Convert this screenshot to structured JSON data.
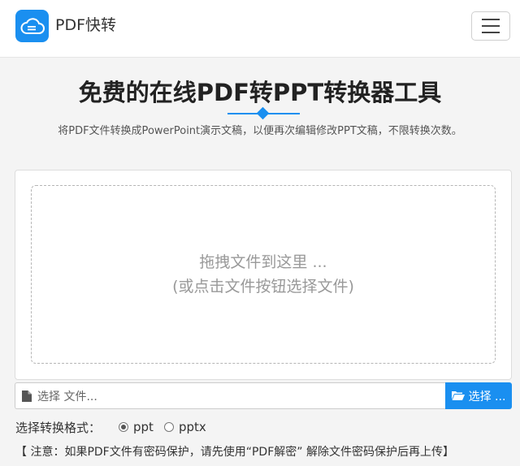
{
  "header": {
    "brand": "PDF快转",
    "logo_icon": "cloud-file-icon",
    "menu_icon": "hamburger-menu-icon",
    "accent": "#1a8ff0"
  },
  "hero": {
    "title": "免费的在线PDF转PPT转换器工具",
    "subtitle": "将PDF文件转换成PowerPoint演示文稿，以便再次编辑修改PPT文稿，不限转换次数。"
  },
  "dropzone": {
    "line1": "拖拽文件到这里 ...",
    "line2": "(或点击文件按钮选择文件)"
  },
  "file_input": {
    "placeholder": "选择 文件...",
    "button_label": "选择 ..."
  },
  "format": {
    "label": "选择转换格式：",
    "options": [
      {
        "label": "ppt",
        "checked": true
      },
      {
        "label": "pptx",
        "checked": false
      }
    ]
  },
  "notice": "【 注意：如果PDF文件有密码保护，请先使用“PDF解密” 解除文件密码保护后再上传】"
}
